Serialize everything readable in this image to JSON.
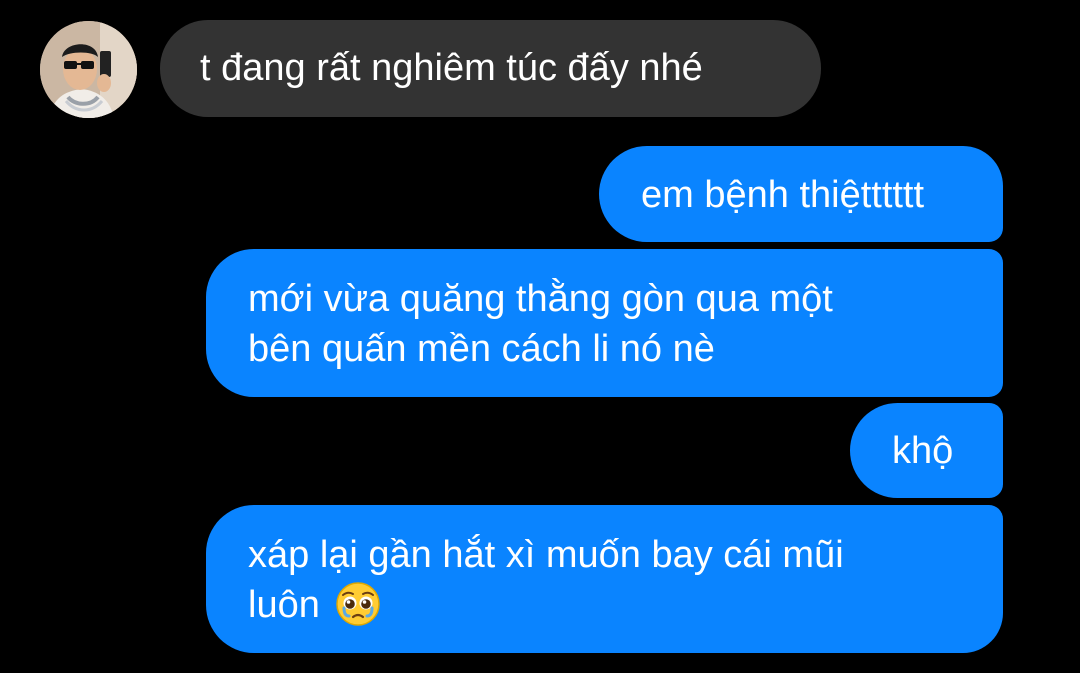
{
  "messages": {
    "incoming_1": {
      "text": "t đang rất nghiêm túc đấy nhé"
    },
    "outgoing_1": {
      "text": "em bệnh thiệtttttt"
    },
    "outgoing_2": {
      "line1": "mới vừa quăng thằng gòn qua một",
      "line2": "bên quấn mền cách li nó nè"
    },
    "outgoing_3": {
      "text": "khộ"
    },
    "outgoing_4": {
      "line1": "xáp lại gần hắt xì muốn bay cái mũi",
      "line2": "luôn",
      "emoji": "pleading-face-icon"
    }
  },
  "colors": {
    "background": "#000000",
    "incoming_bubble": "#333333",
    "outgoing_bubble": "#0a84ff",
    "text": "#ffffff"
  }
}
